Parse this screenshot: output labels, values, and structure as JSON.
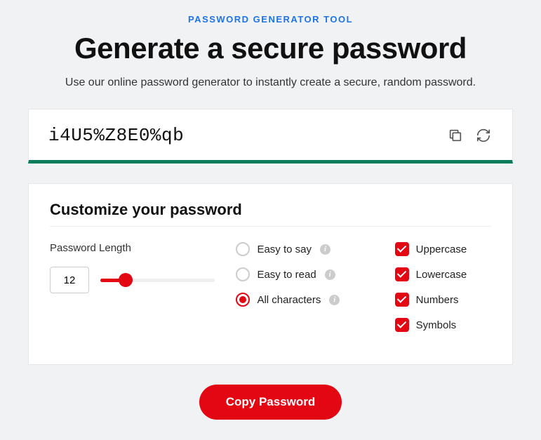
{
  "eyebrow": "PASSWORD GENERATOR TOOL",
  "title": "Generate a secure password",
  "subtitle": "Use our online password generator to instantly create a secure, random password.",
  "password": "i4U5%Z8E0%qb",
  "customize": {
    "title": "Customize your password",
    "length_label": "Password Length",
    "length_value": "12",
    "radios": [
      {
        "label": "Easy to say",
        "selected": false
      },
      {
        "label": "Easy to read",
        "selected": false
      },
      {
        "label": "All characters",
        "selected": true
      }
    ],
    "checks": [
      {
        "label": "Uppercase",
        "checked": true
      },
      {
        "label": "Lowercase",
        "checked": true
      },
      {
        "label": "Numbers",
        "checked": true
      },
      {
        "label": "Symbols",
        "checked": true
      }
    ]
  },
  "copy_button": "Copy Password"
}
